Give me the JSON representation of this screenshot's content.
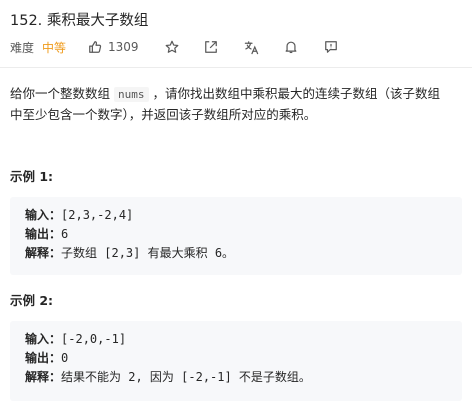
{
  "problem": {
    "title": "152. 乘积最大子数组"
  },
  "meta": {
    "difficulty_label": "难度",
    "difficulty_value": "中等",
    "like_count": "1309",
    "icons": [
      "thumbs-up-icon",
      "star-icon",
      "share-icon",
      "translate-icon",
      "bell-icon",
      "feedback-icon"
    ]
  },
  "description": {
    "line1_part1": "给你一个整数数组",
    "code": "nums",
    "line1_part2": "，请你找出数组中乘积最大的连续子数组（该子数组",
    "line2": "中至少包含一个数字），并返回该子数组所对应的乘积。"
  },
  "examples": [
    {
      "title": "示例 1:",
      "input_label": "输入：",
      "input": "[2,3,-2,4]",
      "output_label": "输出：",
      "output": "6",
      "explain_label": "解释：",
      "explain": "子数组 [2,3] 有最大乘积 6。"
    },
    {
      "title": "示例 2:",
      "input_label": "输入：",
      "input": "[-2,0,-1]",
      "output_label": "输出：",
      "output": "0",
      "explain_label": "解释：",
      "explain": "结果不能为 2, 因为 [-2,-1] 不是子数组。"
    }
  ],
  "colors": {
    "difficulty": "#ef9a1a",
    "example_bg": "#f7f8fa",
    "icon": "#595959"
  }
}
